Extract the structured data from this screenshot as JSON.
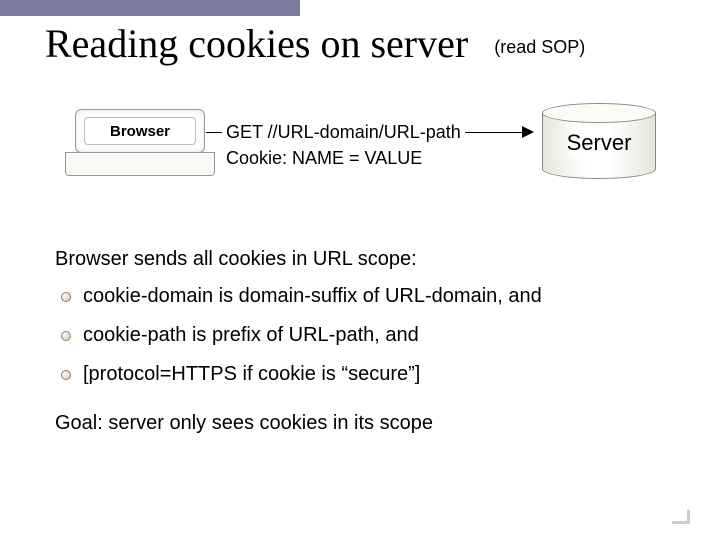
{
  "title": "Reading cookies on server",
  "subtitle": "(read SOP)",
  "diagram": {
    "browser_label": "Browser",
    "request_line1": "GET  //URL-domain/URL-path",
    "request_line2": "Cookie:  NAME = VALUE",
    "server_label": "Server"
  },
  "intro": "Browser sends all cookies in URL scope:",
  "bullets": [
    "cookie-domain is domain-suffix of URL-domain, and",
    "cookie-path is prefix of URL-path, and",
    "[protocol=HTTPS  if cookie is “secure”]"
  ],
  "goal": "Goal:    server only sees cookies in its scope"
}
